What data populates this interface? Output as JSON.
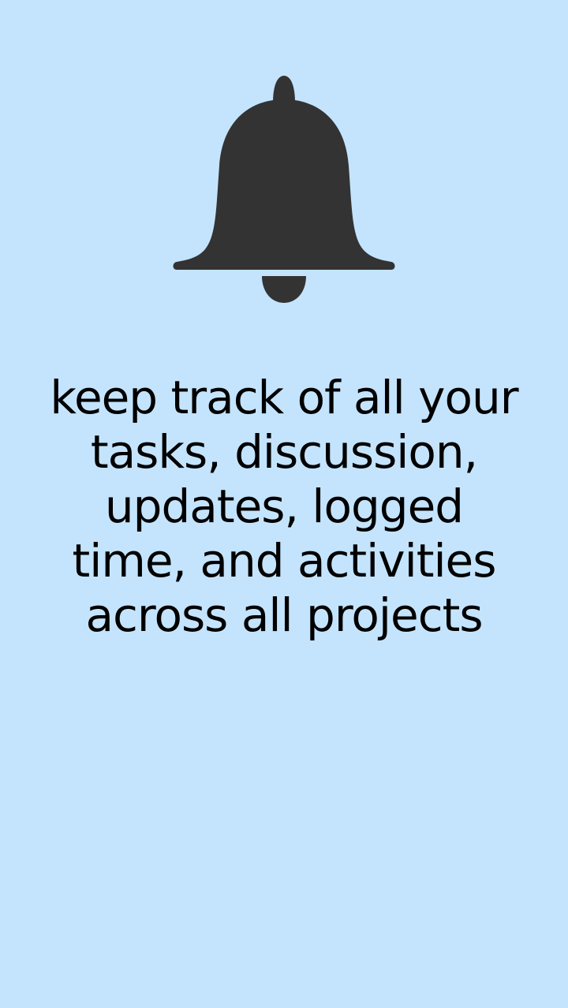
{
  "onboarding": {
    "icon": "bell-icon",
    "message": "keep track of all your tasks, discussion, updates, logged time, and activities across all projects"
  },
  "colors": {
    "background": "#c4e4fd",
    "icon": "#333333",
    "text": "#000000"
  }
}
